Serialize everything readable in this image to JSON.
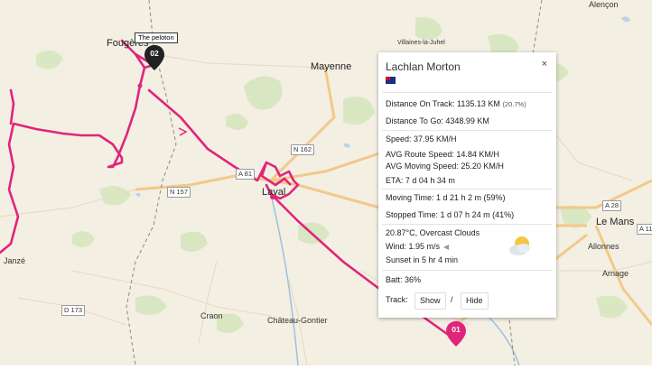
{
  "map": {
    "towns": {
      "fougeres": "Fougères",
      "mayenne": "Mayenne",
      "laval": "Laval",
      "le_mans": "Le Mans",
      "allonnes": "Allonnes",
      "arnage": "Arnage",
      "craon": "Craon",
      "chateau_gontier": "Château-Gontier",
      "janze": "Janzé",
      "alencon": "Alençon",
      "villaines": "Villaines-la-Juhel"
    },
    "roads": {
      "n162": "N 162",
      "n157": "N 157",
      "a81": "A 81",
      "a28": "A 28",
      "a11": "A 11",
      "d173": "D 173"
    },
    "peloton_tag": "The peloton",
    "markers": {
      "peloton": "02",
      "rider": "01"
    },
    "colors": {
      "route": "#e0257a",
      "marker_dark": "#222222",
      "marker_pink": "#e0257a",
      "land": "#f3efe3"
    }
  },
  "panel": {
    "rider_name": "Lachlan Morton",
    "close": "×",
    "flag_icon": "australia-flag-icon",
    "distance_on_track_label": "Distance On Track:",
    "distance_on_track_value": "1135.13 KM",
    "distance_on_track_pct": "(20.7%)",
    "distance_to_go": "Distance To Go: 4348.99 KM",
    "speed": "Speed: 37.95 KM/H",
    "avg_route_speed": "AVG Route Speed: 14.84 KM/H",
    "avg_moving_speed": "AVG Moving Speed: 25.20 KM/H",
    "eta": "ETA: 7 d 04 h 34 m",
    "moving_time": "Moving Time: 1 d 21 h 2 m (59%)",
    "stopped_time": "Stopped Time: 1 d 07 h 24 m (41%)",
    "weather": "20.87°C, Overcast Clouds",
    "wind": "Wind: 1.95 m/s",
    "sunset": "Sunset in 5 hr 4 min",
    "batt": "Batt: 36%",
    "track_label": "Track:",
    "show_label": "Show",
    "slash": "/",
    "hide_label": "Hide",
    "weather_icon": "cloudy-sun-icon"
  }
}
